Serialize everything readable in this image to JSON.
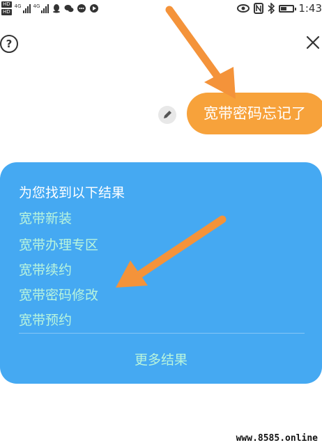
{
  "status_bar": {
    "sim1": "HD",
    "sim2": "HD",
    "net1": "4G",
    "net2": "4G",
    "time": "1:43"
  },
  "chat": {
    "user_message": "宽带密码忘记了"
  },
  "results": {
    "title": "为您找到以下结果",
    "items": [
      {
        "label": "宽带新装"
      },
      {
        "label": "宽带办理专区"
      },
      {
        "label": "宽带续约"
      },
      {
        "label": "宽带密码修改"
      },
      {
        "label": "宽带预约"
      }
    ],
    "more_label": "更多结果"
  },
  "watermark": "www.8585.online",
  "colors": {
    "bubble": "#f7a23b",
    "card": "#45a9f2",
    "link": "#b9f5dd",
    "arrow": "#f4933a"
  }
}
